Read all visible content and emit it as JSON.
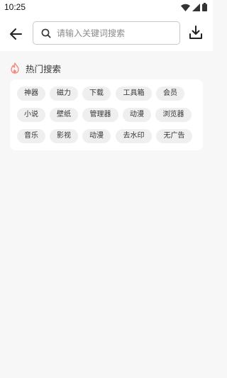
{
  "status_bar": {
    "time": "10:25"
  },
  "search": {
    "placeholder": "请输入关键词搜索",
    "value": ""
  },
  "hot_section": {
    "title": "热门搜索",
    "accent_color": "#f28b82",
    "rows": [
      [
        "神器",
        "磁力",
        "下载",
        "工具箱",
        "会员"
      ],
      [
        "小说",
        "壁纸",
        "管理器",
        "动漫",
        "浏览器"
      ],
      [
        "音乐",
        "影视",
        "动漫",
        "去水印",
        "无广告"
      ]
    ]
  },
  "icons": {
    "back": "arrow-left-icon",
    "search": "search-icon",
    "download": "download-icon",
    "hot": "fire-icon"
  }
}
